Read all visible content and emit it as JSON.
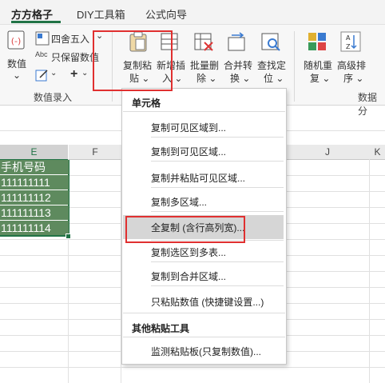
{
  "tabs": [
    {
      "label": "方方格子",
      "active": true
    },
    {
      "label": "DIY工具箱",
      "active": false
    },
    {
      "label": "公式向导",
      "active": false
    }
  ],
  "ribbon": {
    "shuzhi": {
      "line1": "数值",
      "line2": "⌄"
    },
    "sishewuru": "四舍五入",
    "zhibaoliushuzhi": "只保留数值",
    "plus": "+",
    "copy_paste": {
      "line1": "复制粘",
      "line2": "贴 ⌄"
    },
    "new_insert": {
      "line1": "新增插",
      "line2": "入 ⌄"
    },
    "batch_delete": {
      "line1": "批量删",
      "line2": "除 ⌄"
    },
    "merge_convert": {
      "line1": "合并转",
      "line2": "换 ⌄"
    },
    "find_locate": {
      "line1": "查找定",
      "line2": "位 ⌄"
    },
    "random_repeat": {
      "line1": "随机重",
      "line2": "复 ⌄"
    },
    "advanced_sort": {
      "line1": "高级排",
      "line2": "序 ⌄"
    },
    "group_numbers": "数值录入",
    "group_data": "数据分"
  },
  "grid": {
    "col_e": "E",
    "col_f": "F",
    "col_j": "J",
    "col_k": "K",
    "cells_e": [
      "手机号码",
      "111111111",
      "111111112",
      "111111113",
      "111111114"
    ]
  },
  "menu": {
    "section1": "单元格",
    "items1": [
      "复制可见区域到...",
      "复制到可见区域...",
      "复制并粘贴可见区域...",
      "复制多区域...",
      "全复制 (含行高列宽)...",
      "复制选区到多表...",
      "复制到合并区域...",
      "只粘贴数值 (快捷键设置...)"
    ],
    "section2": "其他粘贴工具",
    "items2": [
      "监测粘贴板(只复制数值)..."
    ]
  },
  "colors": {
    "accent": "#217346",
    "highlight_box": "#e03030",
    "selected_fill": "#5e8a5e"
  }
}
